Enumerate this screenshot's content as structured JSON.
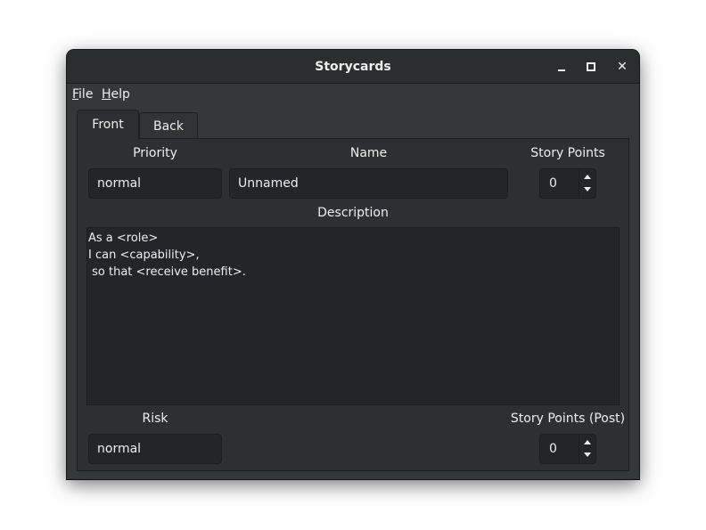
{
  "window": {
    "title": "Storycards"
  },
  "menubar": {
    "file": {
      "mnemonic": "F",
      "rest": "ile"
    },
    "help": {
      "mnemonic": "H",
      "rest": "elp"
    }
  },
  "tabs": [
    {
      "label": "Front",
      "active": true
    },
    {
      "label": "Back",
      "active": false
    }
  ],
  "front": {
    "priority_label": "Priority",
    "priority_value": "normal",
    "name_label": "Name",
    "name_value": "Unnamed",
    "story_points_label": "Story Points",
    "story_points_value": "0",
    "description_label": "Description",
    "description_value": "As a <role>\nI can <capability>,\n so that <receive benefit>.",
    "risk_label": "Risk",
    "risk_value": "normal",
    "story_points_post_label": "Story Points (Post)",
    "story_points_post_value": "0"
  },
  "icons": {
    "minimize": "minimize-icon",
    "maximize": "maximize-icon",
    "close": "close-icon",
    "spin_up": "arrow-up-icon",
    "spin_down": "arrow-down-icon"
  },
  "colors": {
    "window_bg": "#353839",
    "titlebar_bg": "#2b2e2f",
    "panel_bg": "#2d3032",
    "field_bg": "#232628",
    "text": "#eeeeec"
  }
}
